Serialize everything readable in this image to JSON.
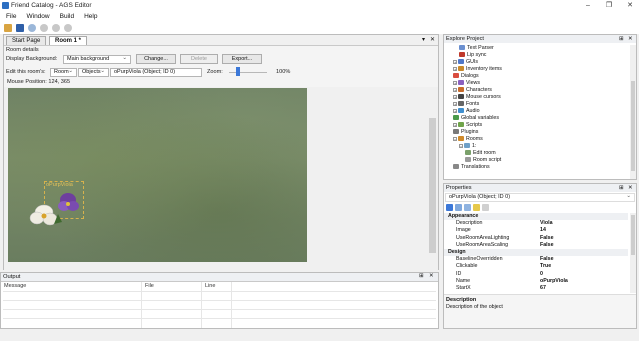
{
  "window": {
    "title": "Friend Catalog - AGS Editor",
    "minimize": "–",
    "maximize": "❐",
    "close": "✕"
  },
  "menu": [
    "File",
    "Window",
    "Build",
    "Help"
  ],
  "tabs": {
    "start_page": "Start Page",
    "room": "Room 1 *",
    "dropdown": "▾",
    "close": "✕"
  },
  "room_details": {
    "header": "Room details",
    "display_bg_label": "Display Background:",
    "display_bg_value": "Main background",
    "change_btn": "Change...",
    "delete_btn": "Delete",
    "export_btn": "Export...",
    "edit_label": "Edit this room's:",
    "edit_type": "Room",
    "edit_sub": "Objects",
    "edit_object": "oPurpViola (Object; ID 0)",
    "zoom_label": "Zoom:",
    "zoom_value": "100%",
    "mouse_position": "Mouse Position: 124, 365"
  },
  "canvas": {
    "object_label": "oPurpViola"
  },
  "output": {
    "title": "Output",
    "pin": "⊞",
    "close": "✕",
    "columns": [
      "Message",
      "File",
      "Line"
    ]
  },
  "explore": {
    "title": "Explore Project",
    "pin": "⊞",
    "close": "✕",
    "items": [
      {
        "label": "Text Parser",
        "indent": 2,
        "icon": "#6a8fd0"
      },
      {
        "label": "Lip sync",
        "indent": 2,
        "icon": "#c0392b"
      },
      {
        "label": "GUIs",
        "indent": 1,
        "icon": "#5078c8",
        "exp": "+"
      },
      {
        "label": "Inventory items",
        "indent": 1,
        "icon": "#c98a2b",
        "exp": "+"
      },
      {
        "label": "Dialogs",
        "indent": 1,
        "icon": "#d94d3f"
      },
      {
        "label": "Views",
        "indent": 1,
        "icon": "#8a60c0",
        "exp": "+"
      },
      {
        "label": "Characters",
        "indent": 1,
        "icon": "#c86b2b",
        "exp": "+"
      },
      {
        "label": "Mouse cursors",
        "indent": 1,
        "icon": "#444",
        "exp": "+"
      },
      {
        "label": "Fonts",
        "indent": 1,
        "icon": "#666",
        "exp": "+"
      },
      {
        "label": "Audio",
        "indent": 1,
        "icon": "#3f8fcf",
        "exp": "+"
      },
      {
        "label": "Global variables",
        "indent": 1,
        "icon": "#4a9a4a"
      },
      {
        "label": "Scripts",
        "indent": 1,
        "icon": "#6fa34a",
        "exp": "+"
      },
      {
        "label": "Plugins",
        "indent": 1,
        "icon": "#7a7a7a"
      },
      {
        "label": "Rooms",
        "indent": 1,
        "icon": "#d08a2a",
        "exp": "−"
      },
      {
        "label": "1:",
        "indent": 2,
        "icon": "#6fa0c8",
        "exp": "−"
      },
      {
        "label": "Edit room",
        "indent": 3,
        "icon": "#7aa06a"
      },
      {
        "label": "Room script",
        "indent": 3,
        "icon": "#9a9a9a"
      },
      {
        "label": "Translations",
        "indent": 1,
        "icon": "#888"
      }
    ]
  },
  "properties": {
    "title": "Properties",
    "pin": "⊞",
    "close": "✕",
    "object": "oPurpViola (Object; ID 0)",
    "rows": [
      {
        "cat": true,
        "k": "Appearance"
      },
      {
        "k": "Description",
        "v": "Viola"
      },
      {
        "k": "Image",
        "v": "14"
      },
      {
        "k": "UseRoomAreaLighting",
        "v": "False"
      },
      {
        "k": "UseRoomAreaScaling",
        "v": "False"
      },
      {
        "cat": true,
        "k": "Design"
      },
      {
        "k": "BaselineOverridden",
        "v": "False"
      },
      {
        "k": "Clickable",
        "v": "True"
      },
      {
        "k": "ID",
        "v": "0"
      },
      {
        "k": "Name",
        "v": "oPurpViola"
      },
      {
        "k": "StartX",
        "v": "67"
      }
    ],
    "desc_title": "Description",
    "desc_text": "Description of the object"
  },
  "colors": {
    "accent": "#3c78d8",
    "panel_header": "#eef0f3"
  }
}
